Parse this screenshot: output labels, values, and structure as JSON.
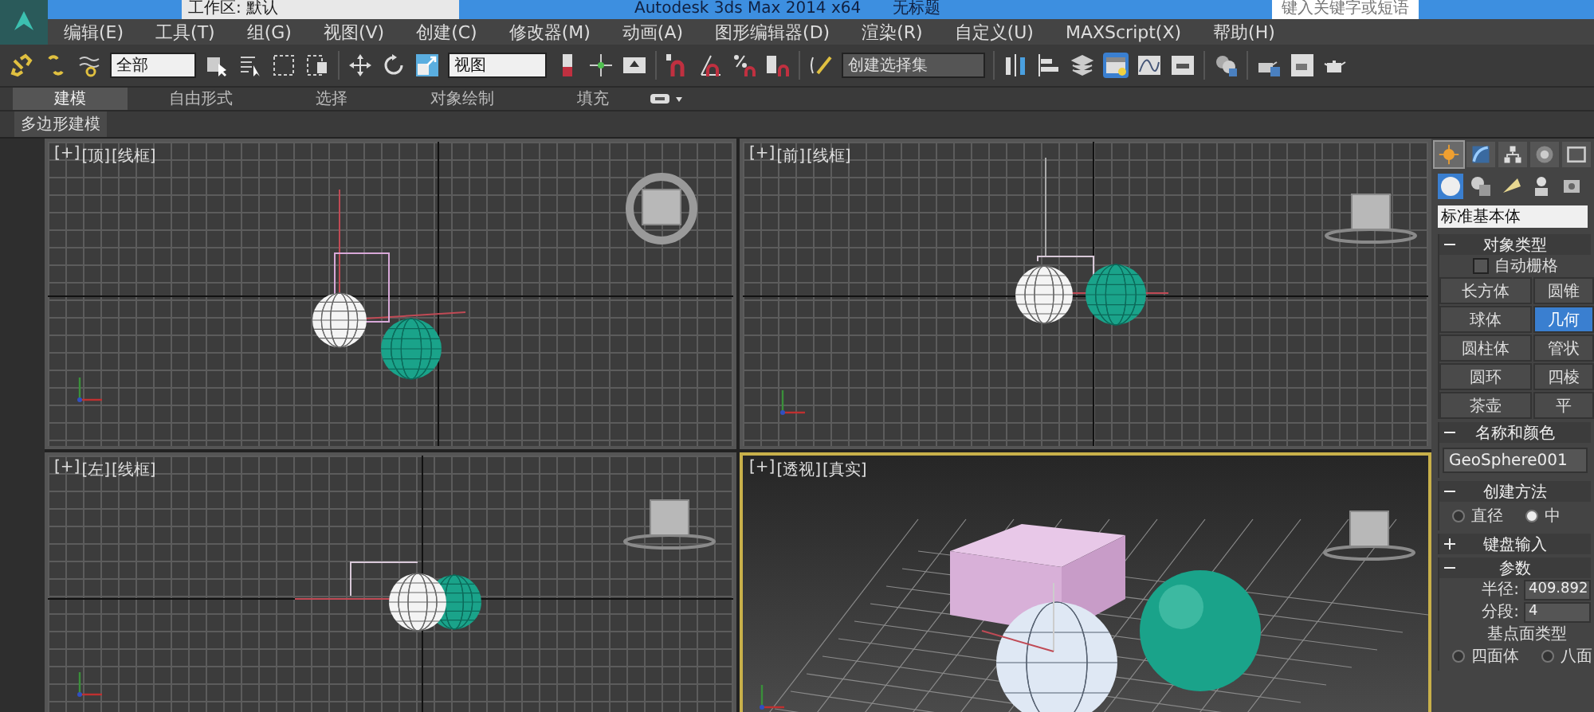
{
  "title_bar": {
    "workspace": "工作区: 默认",
    "title": "Autodesk 3ds Max  2014 x64",
    "document": "无标题",
    "search_placeholder": "键入关键字或短语"
  },
  "menu": [
    "编辑(E)",
    "工具(T)",
    "组(G)",
    "视图(V)",
    "创建(C)",
    "修改器(M)",
    "动画(A)",
    "图形编辑器(D)",
    "渲染(R)",
    "自定义(U)",
    "MAXScript(X)",
    "帮助(H)"
  ],
  "toolbar": {
    "selection_filter": "全部",
    "reference_coordinate": "视图",
    "named_selection": "创建选择集"
  },
  "ribbon": {
    "tabs": [
      {
        "label": "建模",
        "selected": true
      },
      {
        "label": "自由形式",
        "selected": false
      },
      {
        "label": "选择",
        "selected": false
      },
      {
        "label": "对象绘制",
        "selected": false
      },
      {
        "label": "填充",
        "selected": false
      }
    ],
    "panel_button": "多边形建模"
  },
  "viewports": [
    {
      "kind": "top",
      "labels": [
        "[+]",
        "[顶]",
        "[线框]"
      ],
      "active": false
    },
    {
      "kind": "front",
      "labels": [
        "[+]",
        "[前]",
        "[线框]"
      ],
      "active": false
    },
    {
      "kind": "left",
      "labels": [
        "[+]",
        "[左]",
        "[线框]"
      ],
      "active": false
    },
    {
      "kind": "perspective",
      "labels": [
        "[+]",
        "[透视]",
        "[真实]"
      ],
      "active": true
    }
  ],
  "command_panel": {
    "tabs": [
      {
        "selected": true
      },
      {
        "selected": false
      },
      {
        "selected": false
      },
      {
        "selected": false
      },
      {
        "selected": false
      }
    ],
    "categories": [
      {
        "selected": true
      },
      {
        "selected": false
      },
      {
        "selected": false
      },
      {
        "selected": false
      },
      {
        "selected": false
      }
    ],
    "dropdown": "标准基本体",
    "rollouts": [
      {
        "kind": "object_type",
        "title": "对象类型",
        "expanded": true,
        "autogrid": {
          "label": "自动栅格",
          "checked": false
        },
        "buttons": [
          {
            "label": "长方体",
            "selected": false
          },
          {
            "label": "圆锥",
            "selected": false
          },
          {
            "label": "球体",
            "selected": false
          },
          {
            "label": "几何",
            "selected": true
          },
          {
            "label": "圆柱体",
            "selected": false
          },
          {
            "label": "管状",
            "selected": false
          },
          {
            "label": "圆环",
            "selected": false
          },
          {
            "label": "四棱",
            "selected": false
          },
          {
            "label": "茶壶",
            "selected": false
          },
          {
            "label": "平",
            "selected": false
          }
        ]
      },
      {
        "kind": "name_color",
        "title": "名称和颜色",
        "expanded": true,
        "name": "GeoSphere001"
      },
      {
        "kind": "creation_method",
        "title": "创建方法",
        "expanded": true,
        "options": [
          {
            "label": "直径",
            "selected": false
          },
          {
            "label": "中",
            "selected": true
          }
        ]
      },
      {
        "title": "键盘输入",
        "expanded": false
      },
      {
        "kind": "parameters",
        "title": "参数",
        "expanded": true,
        "fields": [
          {
            "label": "半径:",
            "value": "409.892"
          },
          {
            "label": "分段:",
            "value": "4"
          }
        ],
        "group_label": "基点面类型",
        "options": [
          {
            "label": "四面体",
            "selected": false
          },
          {
            "label": "八面",
            "selected": false
          }
        ]
      }
    ]
  }
}
